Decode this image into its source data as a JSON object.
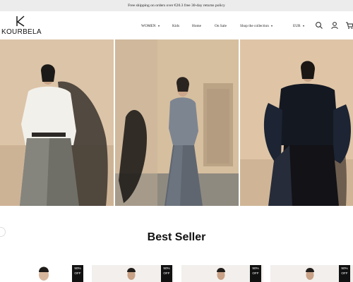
{
  "announcement": "Free shipping on orders over €20.3 free 30-day returns policy",
  "brand": {
    "name": "KOURBELA"
  },
  "nav": {
    "women": "WOMEN",
    "kids": "Kids",
    "home": "Home",
    "on_sale": "On Sale",
    "shop_collection": "Shop the collection",
    "currency": "EUR"
  },
  "icons": [
    "search-icon",
    "account-icon",
    "cart-icon"
  ],
  "section": {
    "best_seller": "Best Seller"
  },
  "products": [
    {
      "badge_pct": "90%",
      "badge_off": "OFF"
    },
    {
      "badge_pct": "90%",
      "badge_off": "OFF"
    },
    {
      "badge_pct": "90%",
      "badge_off": "OFF"
    },
    {
      "badge_pct": "90%",
      "badge_off": "OFF"
    }
  ]
}
